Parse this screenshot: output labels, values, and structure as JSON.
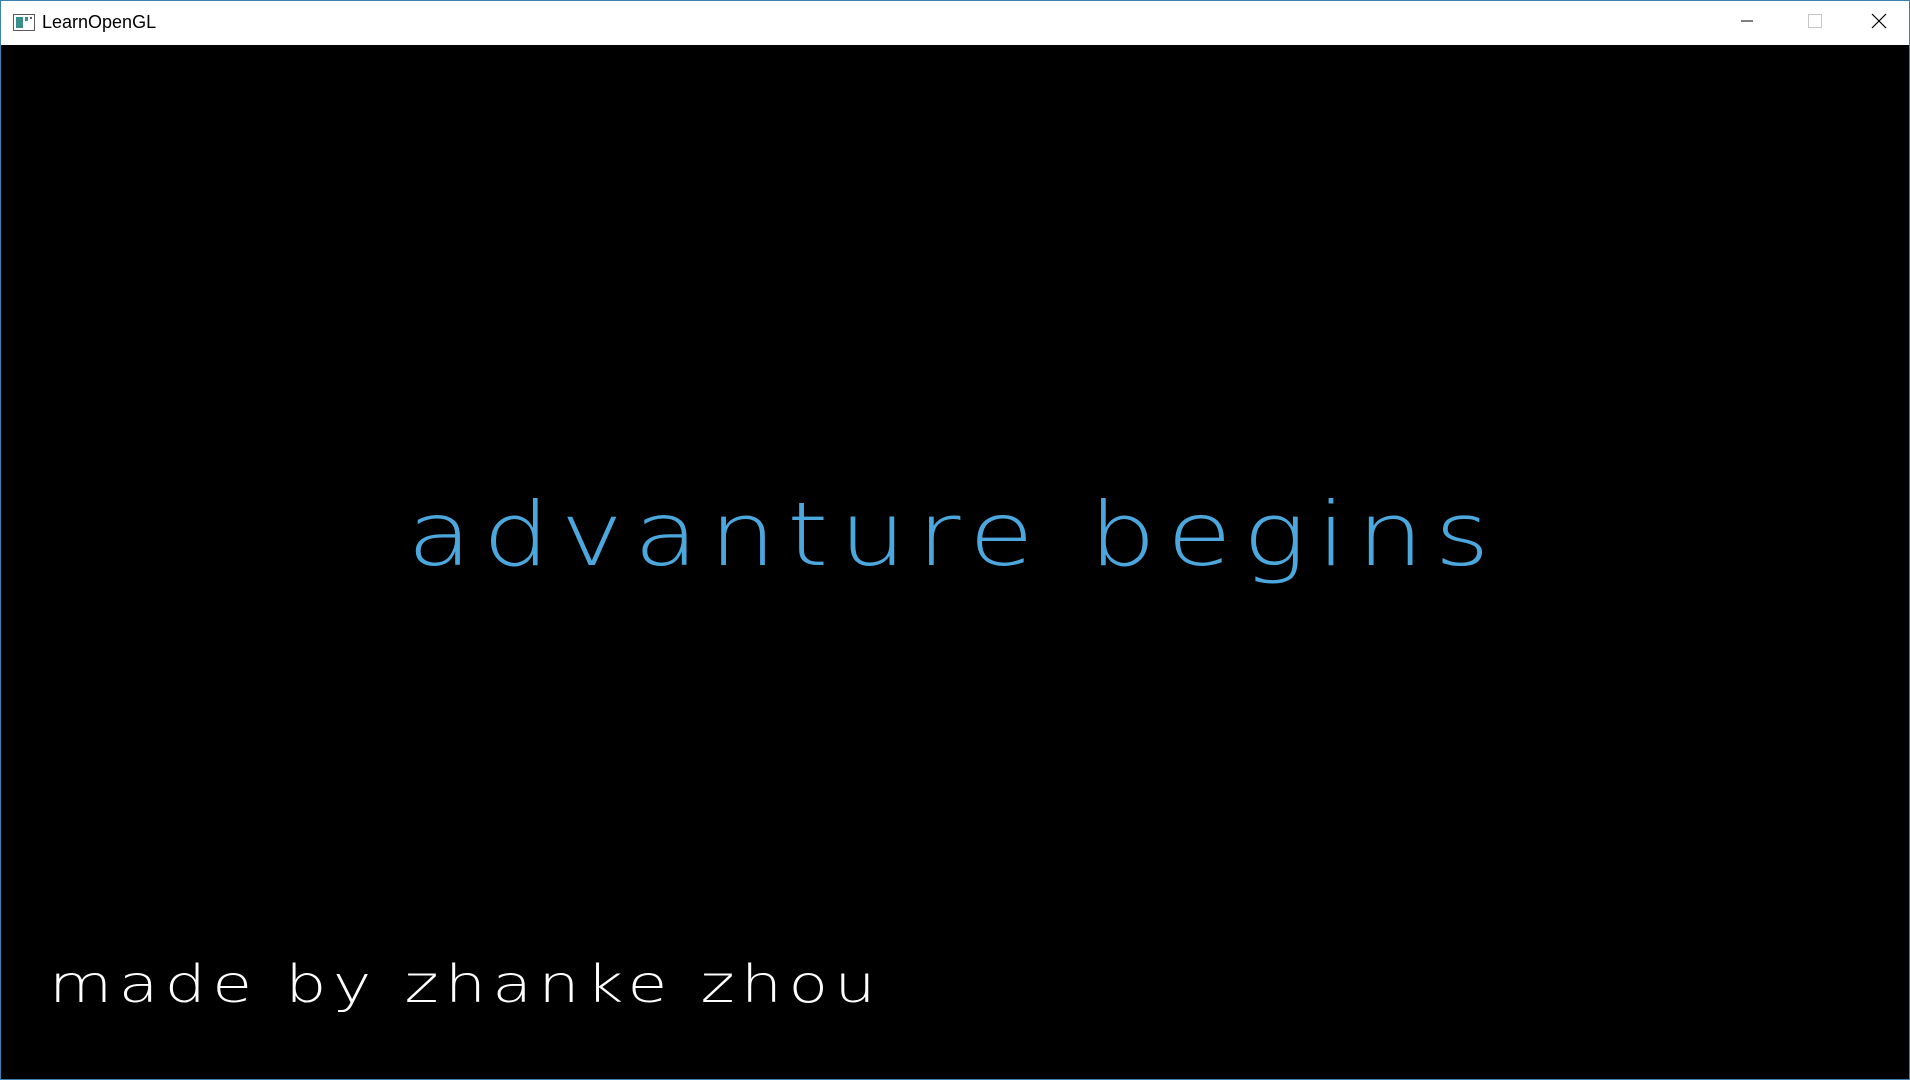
{
  "window": {
    "title": "LearnOpenGL",
    "icon": "opengl-app-icon",
    "border_color": "#3c7fb1",
    "controls": {
      "minimize_icon": "minimize-icon",
      "maximize_icon": "maximize-icon",
      "close_icon": "close-icon"
    }
  },
  "scene": {
    "background_color": "#000000",
    "headline": {
      "text": "advanture begins",
      "color": "#4ba7dc"
    },
    "credit": {
      "text": "made by zhanke zhou",
      "color": "#ffffff"
    }
  }
}
